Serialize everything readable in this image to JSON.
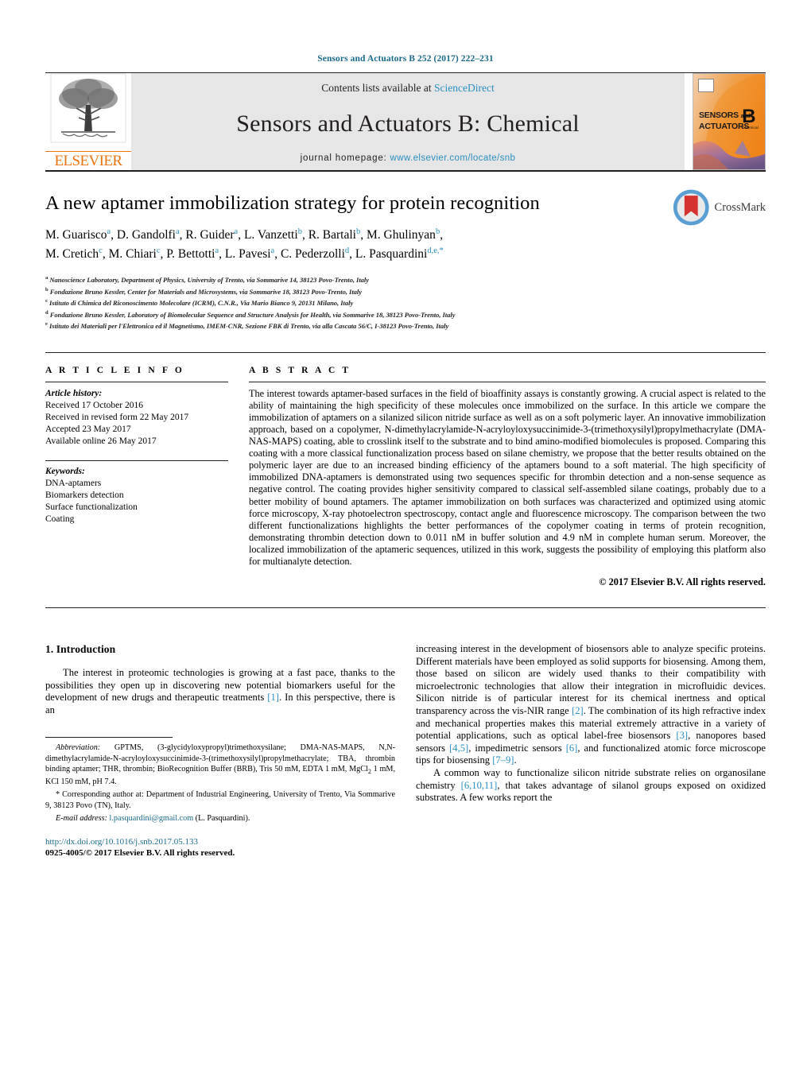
{
  "running_head": "Sensors and Actuators B 252 (2017) 222–231",
  "masthead": {
    "contents_prefix": "Contents lists available at ",
    "sciencedirect": "ScienceDirect",
    "journal_title": "Sensors and Actuators B: Chemical",
    "homepage_label": "journal homepage:",
    "homepage_url": "www.elsevier.com/locate/snb",
    "publisher": "ELSEVIER",
    "cover": {
      "line1": "SENSORS",
      "and": "and",
      "line2": "ACTUATORS",
      "letter": "B",
      "letter_sub": "Chemical"
    },
    "colors": {
      "link": "#2a8fc0",
      "elsevier_orange": "#e87511",
      "band_grey": "#e6e6e6"
    }
  },
  "article": {
    "title": "A new aptamer immobilization strategy for protein recognition",
    "authors_line1": "M. Guarisco|a|, D. Gandolfi|a|, R. Guider|a|, L. Vanzetti|b|, R. Bartali|b|, M. Ghulinyan|b|,",
    "authors_line2": "M. Cretich|c|, M. Chiari|c|, P. Bettotti|a|, L. Pavesi|a|, C. Pederzolli|d|, L. Pasquardini|d,e,*|",
    "crossmark_label": "CrossMark",
    "affiliations": [
      {
        "mark": "a",
        "text": "Nanoscience Laboratory, Department of Physics, University of Trento, via Sommarive 14, 38123 Povo-Trento, Italy"
      },
      {
        "mark": "b",
        "text": "Fondazione Bruno Kessler, Center for Materials and Microsystems, via Sommarive 18, 38123 Povo-Trento, Italy"
      },
      {
        "mark": "c",
        "text": "Istituto di Chimica del Riconoscimento Molecolare (ICRM), C.N.R., Via Mario Bianco 9, 20131 Milano, Italy"
      },
      {
        "mark": "d",
        "text": "Fondazione Bruno Kessler, Laboratory of Biomolecular Sequence and Structure Analysis for Health, via Sommarive 18, 38123 Povo-Trento, Italy"
      },
      {
        "mark": "e",
        "text": "Istituto dei Materiali per l'Elettronica ed il Magnetismo, IMEM-CNR, Sezione FBK di Trento, via alla Cascata 56/C, I-38123 Povo-Trento, Italy"
      }
    ]
  },
  "article_info": {
    "heading": "A R T I C L E  I N F O",
    "history_label": "Article history:",
    "history": [
      "Received 17 October 2016",
      "Received in revised form 22 May 2017",
      "Accepted 23 May 2017",
      "Available online 26 May 2017"
    ],
    "keywords_label": "Keywords:",
    "keywords": [
      "DNA-aptamers",
      "Biomarkers detection",
      "Surface functionalization",
      "Coating"
    ]
  },
  "abstract": {
    "heading": "A B S T R A C T",
    "text": "The interest towards aptamer-based surfaces in the field of bioaffinity assays is constantly growing. A crucial aspect is related to the ability of maintaining the high specificity of these molecules once immobilized on the surface. In this article we compare the immobilization of aptamers on a silanized silicon nitride surface as well as on a soft polymeric layer. An innovative immobilization approach, based on a copolymer, N-dimethylacrylamide-N-acryloyloxysuccinimide-3-(trimethoxysilyl)propylmethacrylate (DMA-NAS-MAPS) coating, able to crosslink itself to the substrate and to bind amino-modified biomolecules is proposed. Comparing this coating with a more classical functionalization process based on silane chemistry, we propose that the better results obtained on the polymeric layer are due to an increased binding efficiency of the aptamers bound to a soft material. The high specificity of immobilized DNA-aptamers is demonstrated using two sequences specific for thrombin detection and a non-sense sequence as negative control. The coating provides higher sensitivity compared to classical self-assembled silane coatings, probably due to a better mobility of bound aptamers. The aptamer immobilization on both surfaces was characterized and optimized using atomic force microscopy, X-ray photoelectron spectroscopy, contact angle and fluorescence microscopy. The comparison between the two different functionalizations highlights the better performances of the copolymer coating in terms of protein recognition, demonstrating thrombin detection down to 0.011 nM in buffer solution and 4.9 nM in complete human serum. Moreover, the localized immobilization of the aptameric sequences, utilized in this work, suggests the possibility of employing this platform also for multianalyte detection.",
    "copyright": "© 2017 Elsevier B.V. All rights reserved."
  },
  "body": {
    "section_heading": "1.  Introduction",
    "left_paragraph_1_a": "The interest in proteomic technologies is growing at a fast pace, thanks to the possibilities they open up in discovering new potential biomarkers useful for the development of new drugs and therapeutic treatments ",
    "left_ref_1": "[1]",
    "left_paragraph_1_b": ". In this perspective, there is an",
    "right_paragraph_1_a": "increasing interest in the development of biosensors able to analyze specific proteins. Different materials have been employed as solid supports for biosensing. Among them, those based on silicon are widely used thanks to their compatibility with microelectronic technologies that allow their integration in microfluidic devices. Silicon nitride is of particular interest for its chemical inertness and optical transparency across the vis-NIR range ",
    "right_ref_2": "[2]",
    "right_paragraph_1_b": ". The combination of its high refractive index and mechanical properties makes this material extremely attractive in a variety of potential applications, such as optical label-free biosensors ",
    "right_ref_3": "[3]",
    "right_paragraph_1_c": ", nanopores based sensors ",
    "right_ref_45": "[4,5]",
    "right_paragraph_1_d": ", impedimetric sensors ",
    "right_ref_6": "[6]",
    "right_paragraph_1_e": ", and functionalized atomic force microscope tips for biosensing ",
    "right_ref_79": "[7–9]",
    "right_paragraph_1_f": ".",
    "right_paragraph_2_a": "A common way to functionalize silicon nitride substrate relies on organosilane chemistry ",
    "right_ref_61011": "[6,10,11]",
    "right_paragraph_2_b": ", that takes advantage of silanol groups exposed on oxidized substrates. A few works report the"
  },
  "footnotes": {
    "abbrev_label": "Abbreviation:",
    "abbrev_text": " GPTMS, (3-glycidyloxypropyl)trimethoxysilane; DMA-NAS-MAPS, N,N-dimethylacrylamide-N-acryloyloxysuccinimide-3-(trimethoxysilyl)propylmethacrylate; TBA, thrombin binding aptamer; THR, thrombin; BioRecognition Buffer (BRB), Tris 50 mM, EDTA 1 mM, MgCl2 1 mM, KCl 150 mM, pH 7.4.",
    "corresponding_marker": "*",
    "corresponding_text": " Corresponding author at: Department of Industrial Engineering, University of Trento, Via Sommarive 9, 38123 Povo (TN), Italy.",
    "email_label": "E-mail address:",
    "email": "l.pasquardini@gmail.com",
    "email_owner": " (L. Pasquardini).",
    "doi": "http://dx.doi.org/10.1016/j.snb.2017.05.133",
    "issn_line": "0925-4005/© 2017 Elsevier B.V. All rights reserved."
  }
}
